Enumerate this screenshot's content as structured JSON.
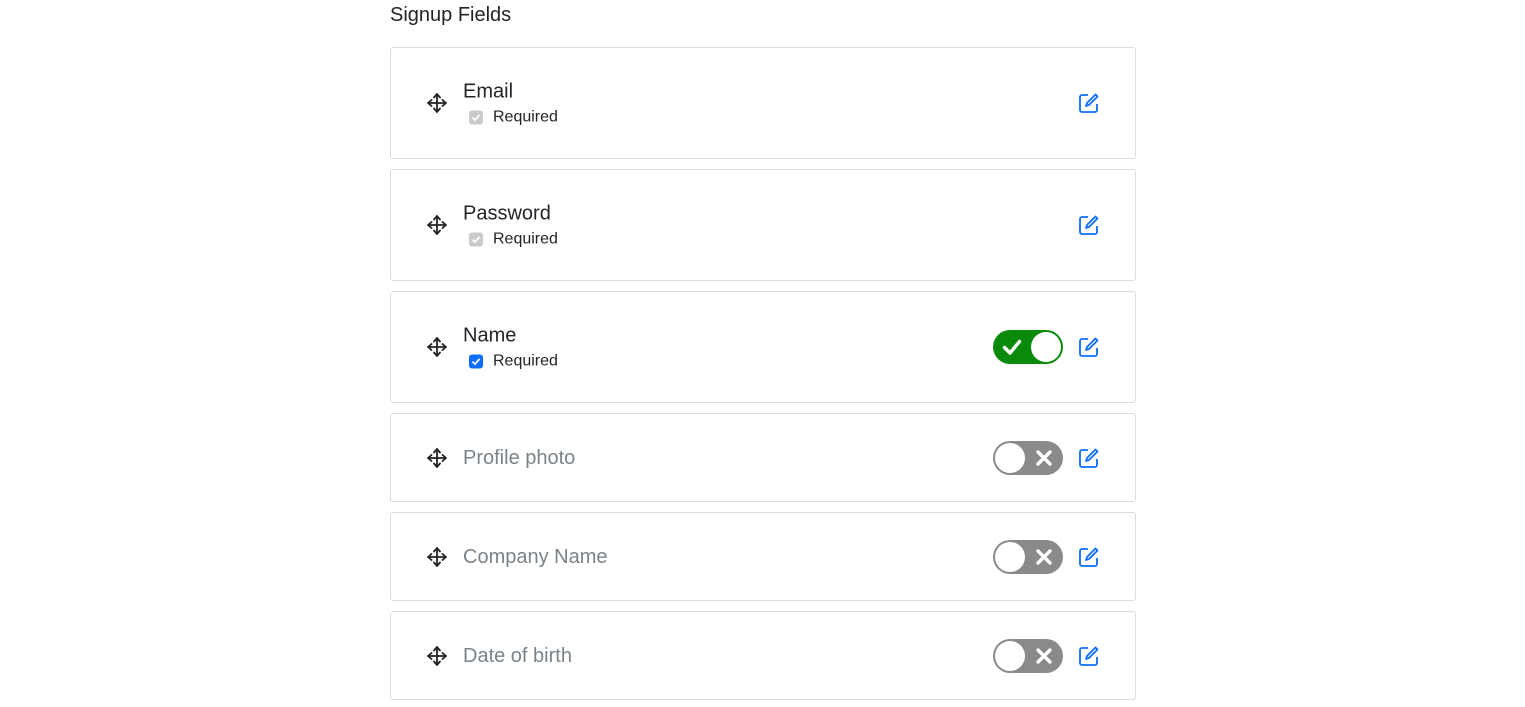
{
  "page": {
    "section_title": "Signup Fields"
  },
  "colors": {
    "accent": "#0d6efd",
    "toggle_on": "#0a8a0a",
    "toggle_off": "#8a8a8a",
    "border": "#dcdcdc",
    "disabled_text": "#7b838a"
  },
  "fields": [
    {
      "name": "Email",
      "required_label": "Required",
      "required_checked": true,
      "required_locked": true,
      "toggle": null,
      "edit_icon": "edit-icon",
      "drag_icon": "move-icon"
    },
    {
      "name": "Password",
      "required_label": "Required",
      "required_checked": true,
      "required_locked": true,
      "toggle": null,
      "edit_icon": "edit-icon",
      "drag_icon": "move-icon"
    },
    {
      "name": "Name",
      "required_label": "Required",
      "required_checked": true,
      "required_locked": false,
      "toggle": "on",
      "edit_icon": "edit-icon",
      "drag_icon": "move-icon"
    },
    {
      "name": "Profile photo",
      "toggle": "off",
      "edit_icon": "edit-icon",
      "drag_icon": "move-icon"
    },
    {
      "name": "Company Name",
      "toggle": "off",
      "edit_icon": "edit-icon",
      "drag_icon": "move-icon"
    },
    {
      "name": "Date of birth",
      "toggle": "off",
      "edit_icon": "edit-icon",
      "drag_icon": "move-icon"
    }
  ]
}
